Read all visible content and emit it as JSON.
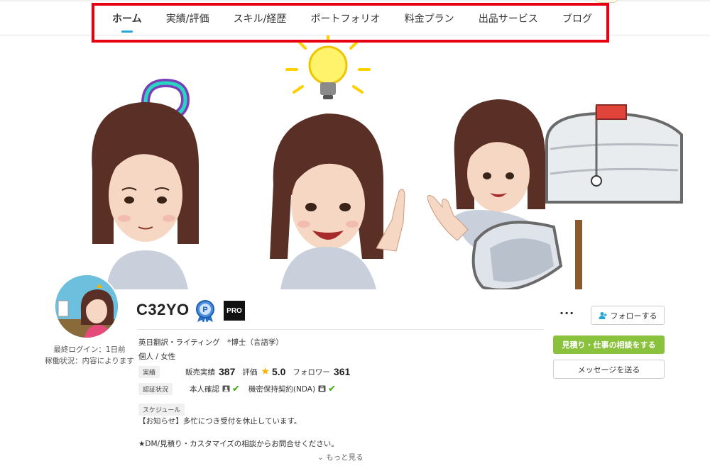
{
  "nav": {
    "items": [
      {
        "label": "ホーム",
        "active": true
      },
      {
        "label": "実績/評価",
        "active": false
      },
      {
        "label": "スキル/経歴",
        "active": false
      },
      {
        "label": "ポートフォリオ",
        "active": false
      },
      {
        "label": "料金プラン",
        "active": false
      },
      {
        "label": "出品サービス",
        "active": false
      },
      {
        "label": "ブログ",
        "active": false
      }
    ],
    "highlight_color": "#e60012",
    "active_underline_color": "#27a6d8"
  },
  "profile": {
    "name": "C32YO",
    "pro_badge": "PRO",
    "rank_badge_icon": "ribbon-medal-icon",
    "last_login": "最終ログイン：1日前",
    "availability": "稼働状況：内容によります",
    "catchphrase": "英日翻訳・ライティング　*博士（言語学）",
    "attributes": "個人 / 女性",
    "stats": {
      "tag": "実績",
      "sales_label": "販売実績",
      "sales_value": "387",
      "rating_label": "評価",
      "rating_value": "5.0",
      "followers_label": "フォロワー",
      "followers_value": "361"
    },
    "verification": {
      "tag": "認証状況",
      "identity_label": "本人確認",
      "nda_label": "機密保持契約(NDA)"
    },
    "schedule_tag": "スケジュール",
    "notice": "【お知らせ】多忙につき受付を休止しています。",
    "notice2": "★DM/見積り・カスタマイズの相談からお問合せください。",
    "more_label": "もっと見る"
  },
  "actions": {
    "more_dots": "···",
    "follow_label": "フォローする",
    "quote_label": "見積り・仕事の相談をする",
    "message_label": "メッセージを送る"
  },
  "colors": {
    "accent_green": "#8ac23d",
    "check_green": "#38a900",
    "star": "#f5b400"
  }
}
